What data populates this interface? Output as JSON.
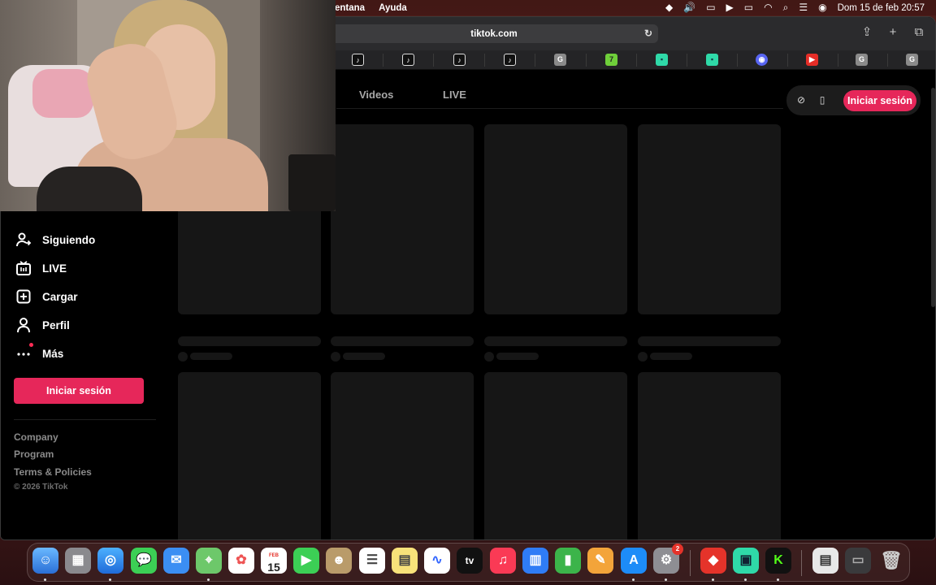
{
  "menubar": {
    "menus": [
      "entana",
      "Ayuda"
    ],
    "clock": "Dom 15 de feb  20:57"
  },
  "browser": {
    "url": "tiktok.com",
    "favorites": [
      "tiktok",
      "tiktok",
      "tiktok",
      "tiktok",
      "G",
      "7",
      "green-app",
      "green-app",
      "discord",
      "youtube",
      "G",
      "G"
    ]
  },
  "tiktok": {
    "tabs": [
      "Videos",
      "LIVE"
    ],
    "login_button": "Iniciar sesión",
    "sidebar": {
      "items": [
        {
          "label": "Siguiendo",
          "icon": "following-icon"
        },
        {
          "label": "LIVE",
          "icon": "live-tv-icon"
        },
        {
          "label": "Cargar",
          "icon": "upload-plus-icon"
        },
        {
          "label": "Perfil",
          "icon": "profile-icon"
        },
        {
          "label": "Más",
          "icon": "more-dots-icon"
        }
      ],
      "login_button": "Iniciar sesión",
      "footer_links": [
        "Company",
        "Program",
        "Terms & Policies"
      ],
      "copyright": "© 2026 TikTok"
    }
  },
  "dock": {
    "calendar_month": "FEB",
    "calendar_day": "15",
    "settings_badge": "2"
  }
}
